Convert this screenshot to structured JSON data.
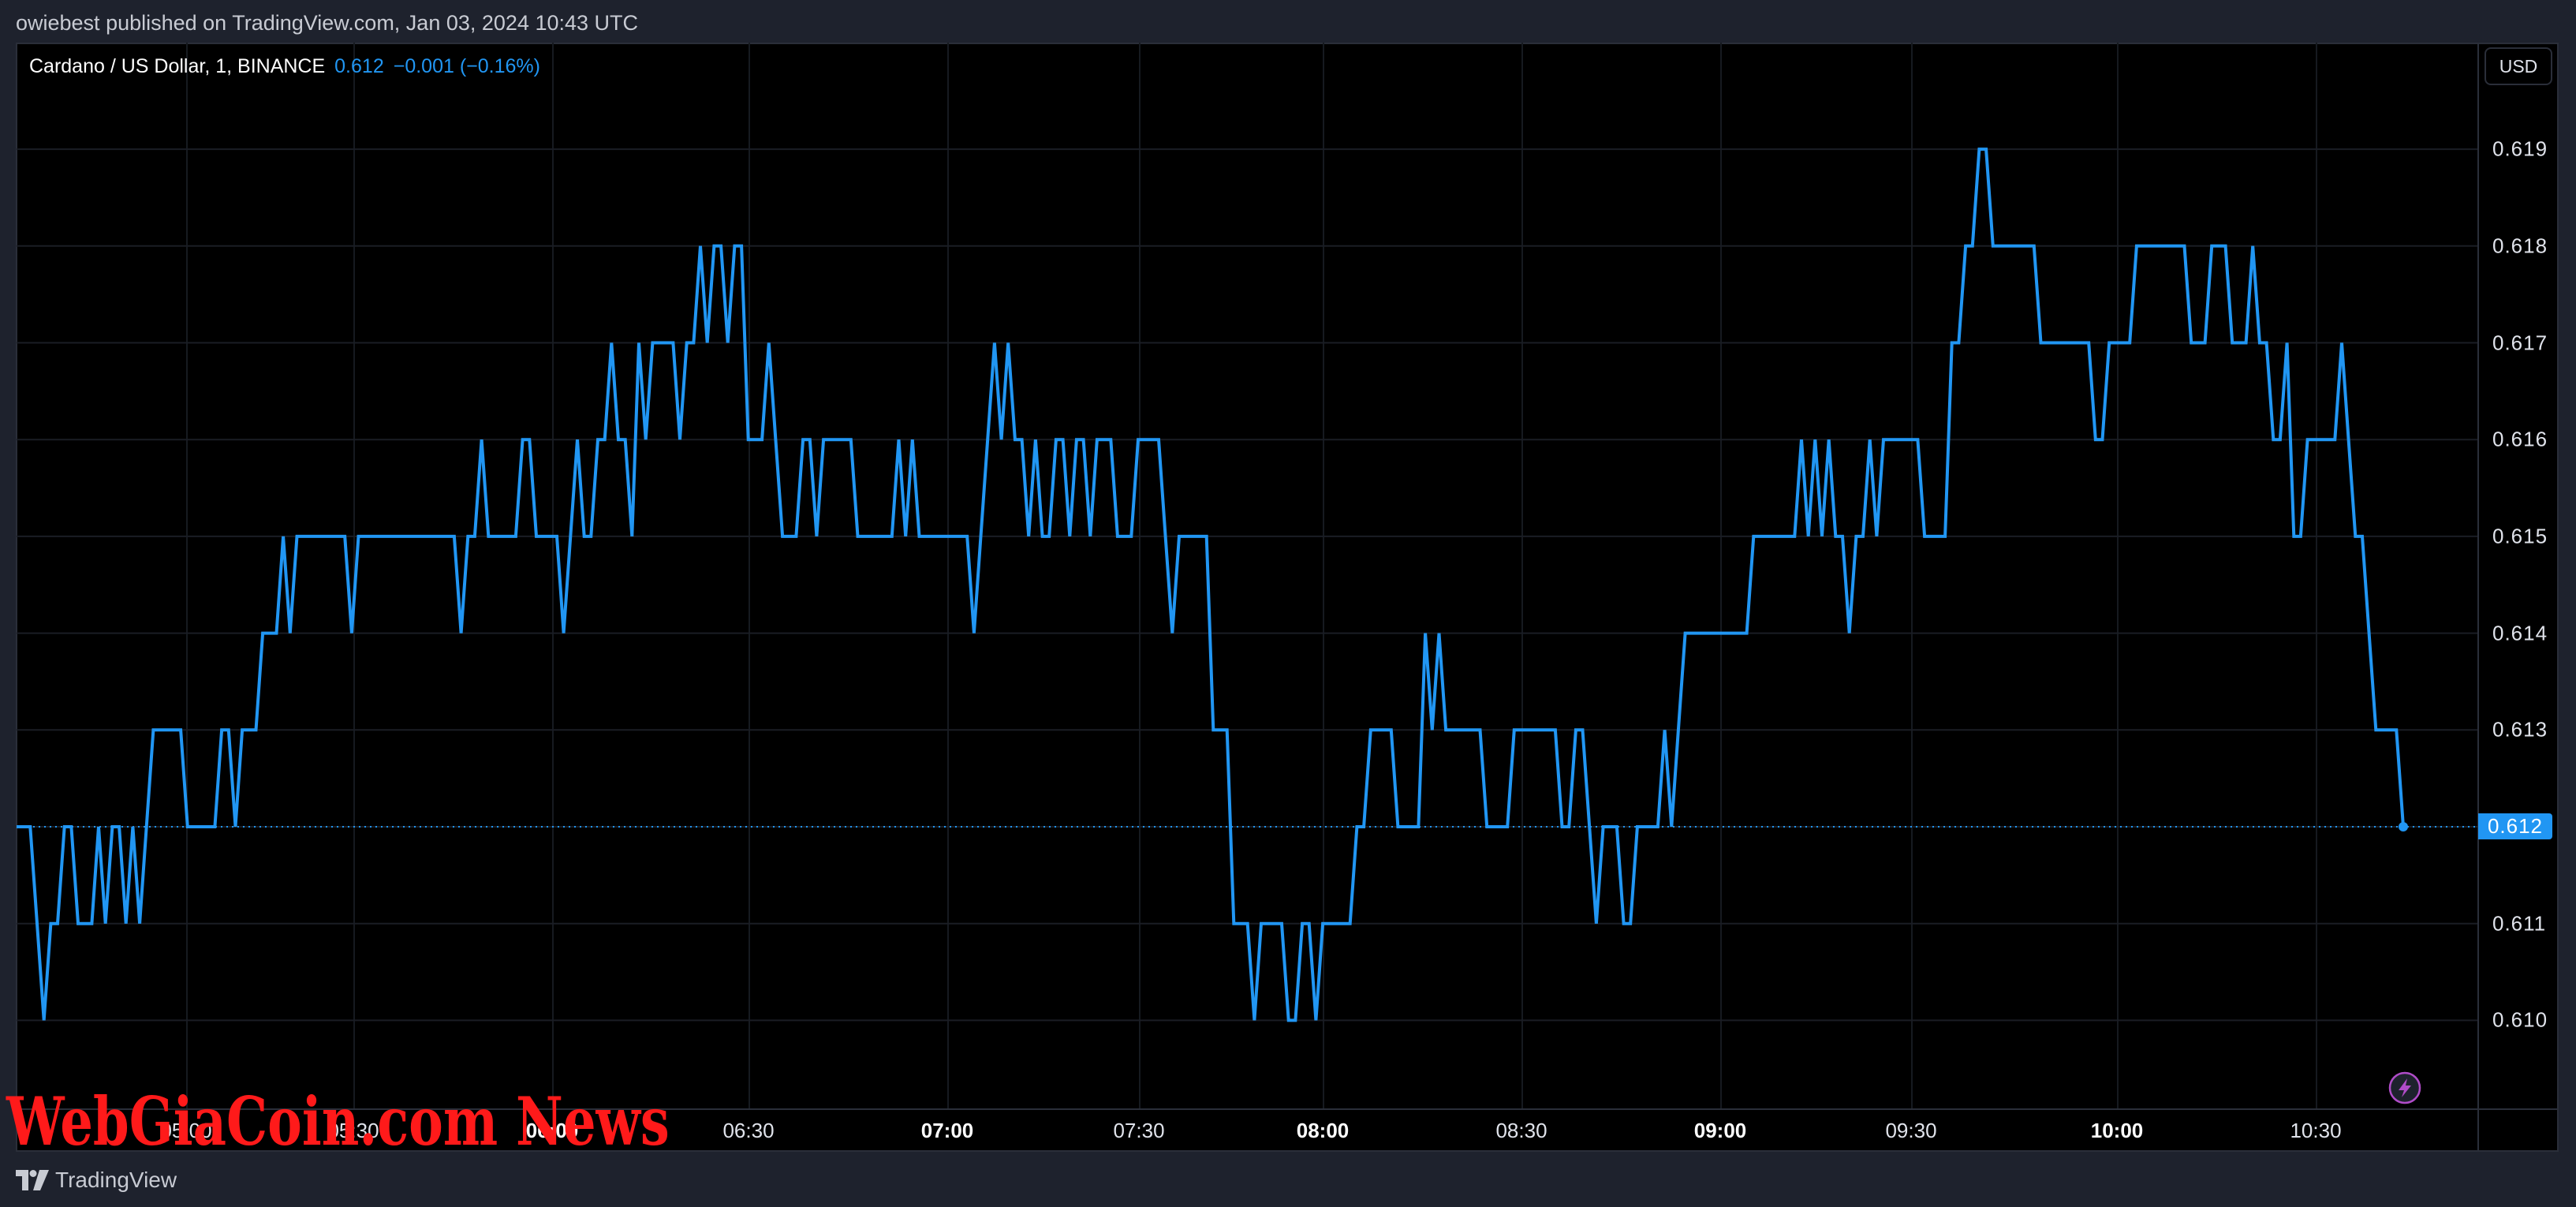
{
  "header": {
    "publish_text": "owiebest published on TradingView.com, Jan 03, 2024 10:43 UTC"
  },
  "legend": {
    "symbol": "Cardano / US Dollar, 1, BINANCE",
    "last": "0.612",
    "change": "−0.001 (−0.16%)"
  },
  "currency_button": "USD",
  "last_price_tag": "0.612",
  "watermark": "WebGiaCoin.com News",
  "footer": {
    "brand": "TradingView"
  },
  "colors": {
    "line": "#2196f3",
    "background": "#000000",
    "panel": "#1e222d",
    "grid": "#1a1d24",
    "watermark": "#ff1a1a",
    "bolt": "#b04cc8"
  },
  "icons": {
    "footer_logo": "tradingview-logo-icon",
    "bolt": "lightning-bolt-icon"
  },
  "chart_data": {
    "type": "line",
    "title": "Cardano / US Dollar, 1, BINANCE",
    "interval": "1",
    "x_ticks": [
      "05:00",
      "05:30",
      "06:00",
      "06:30",
      "07:00",
      "07:30",
      "08:00",
      "08:30",
      "09:00",
      "09:30",
      "10:00",
      "10:30"
    ],
    "y_ticks": [
      "0.610",
      "0.611",
      "0.612",
      "0.613",
      "0.614",
      "0.615",
      "0.616",
      "0.617",
      "0.618",
      "0.619"
    ],
    "ylim": [
      0.6089,
      0.6201
    ],
    "grid": true,
    "last_value": 0.612,
    "values": [
      0.612,
      0.612,
      0.612,
      0.611,
      0.61,
      0.611,
      0.611,
      0.612,
      0.612,
      0.611,
      0.611,
      0.611,
      0.612,
      0.611,
      0.612,
      0.612,
      0.611,
      0.612,
      0.611,
      0.612,
      0.613,
      0.613,
      0.613,
      0.613,
      0.613,
      0.612,
      0.612,
      0.612,
      0.612,
      0.612,
      0.613,
      0.613,
      0.612,
      0.613,
      0.613,
      0.613,
      0.614,
      0.614,
      0.614,
      0.615,
      0.614,
      0.615,
      0.615,
      0.615,
      0.615,
      0.615,
      0.615,
      0.615,
      0.615,
      0.614,
      0.615,
      0.615,
      0.615,
      0.615,
      0.615,
      0.615,
      0.615,
      0.615,
      0.615,
      0.615,
      0.615,
      0.615,
      0.615,
      0.615,
      0.615,
      0.614,
      0.615,
      0.615,
      0.616,
      0.615,
      0.615,
      0.615,
      0.615,
      0.615,
      0.616,
      0.616,
      0.615,
      0.615,
      0.615,
      0.615,
      0.614,
      0.615,
      0.616,
      0.615,
      0.615,
      0.616,
      0.616,
      0.617,
      0.616,
      0.616,
      0.615,
      0.617,
      0.616,
      0.617,
      0.617,
      0.617,
      0.617,
      0.616,
      0.617,
      0.617,
      0.618,
      0.617,
      0.618,
      0.618,
      0.617,
      0.618,
      0.618,
      0.616,
      0.616,
      0.616,
      0.617,
      0.616,
      0.615,
      0.615,
      0.615,
      0.616,
      0.616,
      0.615,
      0.616,
      0.616,
      0.616,
      0.616,
      0.616,
      0.615,
      0.615,
      0.615,
      0.615,
      0.615,
      0.615,
      0.616,
      0.615,
      0.616,
      0.615,
      0.615,
      0.615,
      0.615,
      0.615,
      0.615,
      0.615,
      0.615,
      0.614,
      0.615,
      0.616,
      0.617,
      0.616,
      0.617,
      0.616,
      0.616,
      0.615,
      0.616,
      0.615,
      0.615,
      0.616,
      0.616,
      0.615,
      0.616,
      0.616,
      0.615,
      0.616,
      0.616,
      0.616,
      0.615,
      0.615,
      0.615,
      0.616,
      0.616,
      0.616,
      0.616,
      0.615,
      0.614,
      0.615,
      0.615,
      0.615,
      0.615,
      0.615,
      0.613,
      0.613,
      0.613,
      0.611,
      0.611,
      0.611,
      0.61,
      0.611,
      0.611,
      0.611,
      0.611,
      0.61,
      0.61,
      0.611,
      0.611,
      0.61,
      0.611,
      0.611,
      0.611,
      0.611,
      0.611,
      0.612,
      0.612,
      0.613,
      0.613,
      0.613,
      0.613,
      0.612,
      0.612,
      0.612,
      0.612,
      0.614,
      0.613,
      0.614,
      0.613,
      0.613,
      0.613,
      0.613,
      0.613,
      0.613,
      0.612,
      0.612,
      0.612,
      0.612,
      0.613,
      0.613,
      0.613,
      0.613,
      0.613,
      0.613,
      0.613,
      0.612,
      0.612,
      0.613,
      0.613,
      0.612,
      0.611,
      0.612,
      0.612,
      0.612,
      0.611,
      0.611,
      0.612,
      0.612,
      0.612,
      0.612,
      0.613,
      0.612,
      0.613,
      0.614,
      0.614,
      0.614,
      0.614,
      0.614,
      0.614,
      0.614,
      0.614,
      0.614,
      0.614,
      0.615,
      0.615,
      0.615,
      0.615,
      0.615,
      0.615,
      0.615,
      0.616,
      0.615,
      0.616,
      0.615,
      0.616,
      0.615,
      0.615,
      0.614,
      0.615,
      0.615,
      0.616,
      0.615,
      0.616,
      0.616,
      0.616,
      0.616,
      0.616,
      0.616,
      0.615,
      0.615,
      0.615,
      0.615,
      0.617,
      0.617,
      0.618,
      0.618,
      0.619,
      0.619,
      0.618,
      0.618,
      0.618,
      0.618,
      0.618,
      0.618,
      0.618,
      0.617,
      0.617,
      0.617,
      0.617,
      0.617,
      0.617,
      0.617,
      0.617,
      0.616,
      0.616,
      0.617,
      0.617,
      0.617,
      0.617,
      0.618,
      0.618,
      0.618,
      0.618,
      0.618,
      0.618,
      0.618,
      0.618,
      0.617,
      0.617,
      0.617,
      0.618,
      0.618,
      0.618,
      0.617,
      0.617,
      0.617,
      0.618,
      0.617,
      0.617,
      0.616,
      0.616,
      0.617,
      0.615,
      0.615,
      0.616,
      0.616,
      0.616,
      0.616,
      0.616,
      0.617,
      0.616,
      0.615,
      0.615,
      0.614,
      0.613,
      0.613,
      0.613,
      0.613,
      0.612
    ]
  }
}
